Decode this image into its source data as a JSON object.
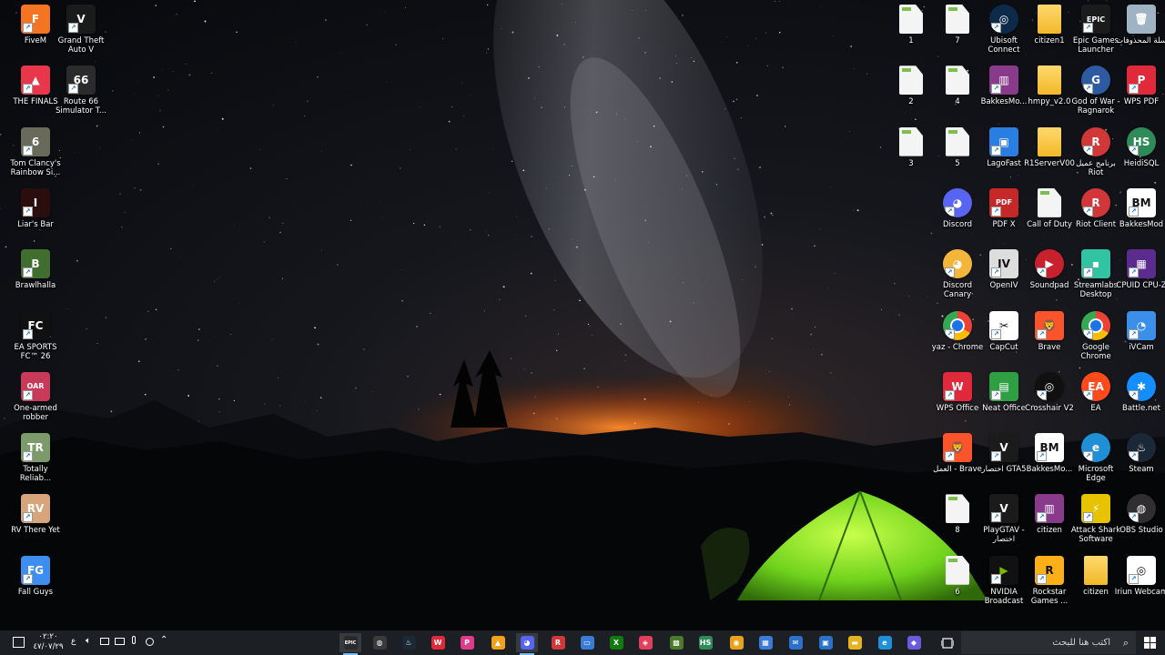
{
  "desktop": {
    "icons": [
      {
        "label": "FiveM",
        "bg": "#f47421",
        "glyph": "F",
        "shortcut": true,
        "col": 0,
        "row": 0
      },
      {
        "label": "Grand Theft Auto V",
        "bg": "#1b1b1b",
        "glyph": "V",
        "shortcut": true,
        "col": 1,
        "row": 0
      },
      {
        "label": "THE FINALS",
        "bg": "#e8374a",
        "glyph": "▲",
        "shortcut": true,
        "col": 0,
        "row": 1
      },
      {
        "label": "Route 66 Simulator T...",
        "bg": "#2b2b2b",
        "glyph": "66",
        "shortcut": true,
        "col": 1,
        "row": 1
      },
      {
        "label": "Tom Clancy's Rainbow Si...",
        "bg": "#6a6a5a",
        "glyph": "6",
        "shortcut": true,
        "col": 0,
        "row": 2
      },
      {
        "label": "Liar's Bar",
        "bg": "#2a0d0d",
        "glyph": "I",
        "shortcut": true,
        "col": 0,
        "row": 3
      },
      {
        "label": "Brawlhalla",
        "bg": "#3f6e2f",
        "glyph": "B",
        "shortcut": true,
        "col": 0,
        "row": 4
      },
      {
        "label": "EA SPORTS FC™ 26",
        "bg": "#111111",
        "glyph": "FC",
        "shortcut": true,
        "col": 0,
        "row": 5
      },
      {
        "label": "One-armed robber",
        "bg": "#c93a5a",
        "glyph": "OAR",
        "shortcut": true,
        "col": 0,
        "row": 6
      },
      {
        "label": "Totally Reliab...",
        "bg": "#7c9a6a",
        "glyph": "TR",
        "shortcut": true,
        "col": 0,
        "row": 7
      },
      {
        "label": "RV There Yet",
        "bg": "#d8a47c",
        "glyph": "RV",
        "shortcut": true,
        "col": 0,
        "row": 8
      },
      {
        "label": "Fall Guys",
        "bg": "#3d8ef0",
        "glyph": "FG",
        "shortcut": true,
        "col": 0,
        "row": 9
      },
      {
        "label": "1",
        "type": "file",
        "col": 2,
        "row": 0
      },
      {
        "label": "7",
        "type": "file",
        "col": 3,
        "row": 0
      },
      {
        "label": "Ubisoft Connect",
        "bg": "#0e2a4a",
        "glyph": "◎",
        "shortcut": true,
        "col": 4,
        "row": 0,
        "round": true
      },
      {
        "label": "citizen1",
        "type": "folder",
        "col": 5,
        "row": 0
      },
      {
        "label": "Epic Games Launcher",
        "bg": "#1b1b1b",
        "glyph": "EPIC",
        "shortcut": true,
        "col": 6,
        "row": 0
      },
      {
        "label": "سلة المحذوفات",
        "bg": "#9fb3c4",
        "glyph": "🗑",
        "shortcut": false,
        "col": 7,
        "row": 0
      },
      {
        "label": "2",
        "type": "file",
        "col": 2,
        "row": 1
      },
      {
        "label": "4",
        "type": "file",
        "col": 3,
        "row": 1
      },
      {
        "label": "BakkesMo...",
        "bg": "#8a3a8a",
        "glyph": "▥",
        "shortcut": true,
        "col": 4,
        "row": 1
      },
      {
        "label": "hmpy_v2.0",
        "type": "folder",
        "col": 5,
        "row": 1
      },
      {
        "label": "God of War - Ragnarok",
        "bg": "#2d5aa0",
        "glyph": "G",
        "shortcut": true,
        "col": 6,
        "row": 1,
        "round": true
      },
      {
        "label": "WPS PDF",
        "bg": "#e02a3c",
        "glyph": "P",
        "shortcut": true,
        "col": 7,
        "row": 1
      },
      {
        "label": "3",
        "type": "file",
        "col": 2,
        "row": 2
      },
      {
        "label": "5",
        "type": "file",
        "col": 3,
        "row": 2
      },
      {
        "label": "LagoFast",
        "bg": "#2a7de1",
        "glyph": "▣",
        "shortcut": true,
        "col": 4,
        "row": 2
      },
      {
        "label": "R1ServerV00",
        "type": "folder",
        "col": 5,
        "row": 2
      },
      {
        "label": "برنامج عميل Riot",
        "bg": "#d13639",
        "glyph": "R",
        "shortcut": true,
        "col": 6,
        "row": 2,
        "round": true
      },
      {
        "label": "HeidiSQL",
        "bg": "#2e8b57",
        "glyph": "HS",
        "shortcut": true,
        "col": 7,
        "row": 2,
        "round": true
      },
      {
        "label": "Discord",
        "bg": "#5865f2",
        "glyph": "◕",
        "shortcut": true,
        "col": 3,
        "row": 3,
        "round": true
      },
      {
        "label": "PDF X",
        "bg": "#c62828",
        "glyph": "PDF",
        "shortcut": true,
        "col": 4,
        "row": 3
      },
      {
        "label": "Call of Duty",
        "type": "file",
        "col": 5,
        "row": 3
      },
      {
        "label": "Riot Client",
        "bg": "#d13639",
        "glyph": "R",
        "shortcut": true,
        "col": 6,
        "row": 3,
        "round": true
      },
      {
        "label": "BakkesMod",
        "bg": "#ffffff",
        "glyph": "BM",
        "shortcut": true,
        "col": 7,
        "row": 3,
        "dark": true
      },
      {
        "label": "Discord Canary",
        "bg": "#f4b63a",
        "glyph": "◕",
        "shortcut": true,
        "col": 3,
        "row": 4,
        "round": true
      },
      {
        "label": "OpenIV",
        "bg": "#dddddd",
        "glyph": "IV",
        "shortcut": true,
        "col": 4,
        "row": 4,
        "dark": true
      },
      {
        "label": "Soundpad",
        "bg": "#c8202c",
        "glyph": "▶",
        "shortcut": true,
        "col": 5,
        "row": 4,
        "round": true
      },
      {
        "label": "Streamlabs Desktop",
        "bg": "#31c3a2",
        "glyph": "▪",
        "shortcut": true,
        "col": 6,
        "row": 4
      },
      {
        "label": "CPUID CPU-Z",
        "bg": "#5b2c8e",
        "glyph": "▦",
        "shortcut": true,
        "col": 7,
        "row": 4
      },
      {
        "label": "yaz - Chrome",
        "bg": "#ffffff",
        "glyph": "◉",
        "shortcut": true,
        "col": 3,
        "row": 5,
        "round": true,
        "chrome": true
      },
      {
        "label": "CapCut",
        "bg": "#ffffff",
        "glyph": "✂",
        "shortcut": true,
        "col": 4,
        "row": 5,
        "dark": true
      },
      {
        "label": "Brave",
        "bg": "#fb542b",
        "glyph": "🦁",
        "shortcut": true,
        "col": 5,
        "row": 5
      },
      {
        "label": "Google Chrome",
        "bg": "#ffffff",
        "glyph": "◉",
        "shortcut": true,
        "col": 6,
        "row": 5,
        "round": true,
        "chrome": true
      },
      {
        "label": "iVCam",
        "bg": "#3b8fe8",
        "glyph": "◔",
        "shortcut": true,
        "col": 7,
        "row": 5
      },
      {
        "label": "WPS Office",
        "bg": "#e02a3c",
        "glyph": "W",
        "shortcut": true,
        "col": 3,
        "row": 6
      },
      {
        "label": "Neat Office",
        "bg": "#2ea043",
        "glyph": "▤",
        "shortcut": true,
        "col": 4,
        "row": 6
      },
      {
        "label": "Crosshair V2",
        "bg": "#101010",
        "glyph": "◎",
        "shortcut": true,
        "col": 5,
        "row": 6,
        "round": true
      },
      {
        "label": "EA",
        "bg": "#ff4a1c",
        "glyph": "EA",
        "shortcut": true,
        "col": 6,
        "row": 6,
        "round": true
      },
      {
        "label": "Battle.net",
        "bg": "#148eff",
        "glyph": "✱",
        "shortcut": true,
        "col": 7,
        "row": 6,
        "round": true
      },
      {
        "label": "العمل - Brave",
        "bg": "#fb542b",
        "glyph": "🦁",
        "shortcut": true,
        "col": 3,
        "row": 7
      },
      {
        "label": "اختصار GTA5",
        "bg": "#1b1b1b",
        "glyph": "V",
        "shortcut": true,
        "col": 4,
        "row": 7
      },
      {
        "label": "BakkesMo...",
        "bg": "#ffffff",
        "glyph": "BM",
        "shortcut": true,
        "col": 5,
        "row": 7,
        "dark": true
      },
      {
        "label": "Microsoft Edge",
        "bg": "#1f8fd6",
        "glyph": "e",
        "shortcut": true,
        "col": 6,
        "row": 7,
        "round": true
      },
      {
        "label": "Steam",
        "bg": "#1b2838",
        "glyph": "♨",
        "shortcut": true,
        "col": 7,
        "row": 7,
        "round": true
      },
      {
        "label": "8",
        "type": "file",
        "col": 3,
        "row": 8
      },
      {
        "label": "PlayGTAV - اختصار",
        "bg": "#1b1b1b",
        "glyph": "V",
        "shortcut": true,
        "col": 4,
        "row": 8
      },
      {
        "label": "citizen",
        "bg": "#8a3a8a",
        "glyph": "▥",
        "shortcut": true,
        "col": 5,
        "row": 8
      },
      {
        "label": "Attack Shark Software",
        "bg": "#e6c200",
        "glyph": "⚡",
        "shortcut": true,
        "col": 6,
        "row": 8
      },
      {
        "label": "OBS Studio",
        "bg": "#302e31",
        "glyph": "◍",
        "shortcut": true,
        "col": 7,
        "row": 8,
        "round": true
      },
      {
        "label": "6",
        "type": "file",
        "col": 3,
        "row": 9
      },
      {
        "label": "NVIDIA Broadcast",
        "bg": "#111111",
        "glyph": "▶",
        "shortcut": true,
        "col": 4,
        "row": 9,
        "nv": true
      },
      {
        "label": "Rockstar Games ...",
        "bg": "#fcaf17",
        "glyph": "R",
        "shortcut": true,
        "col": 5,
        "row": 9,
        "dark": true
      },
      {
        "label": "citizen",
        "type": "folder",
        "col": 6,
        "row": 9
      },
      {
        "label": "Iriun Webcam",
        "bg": "#ffffff",
        "glyph": "◎",
        "shortcut": true,
        "col": 7,
        "row": 9,
        "dark": true
      }
    ]
  },
  "taskbar": {
    "search_placeholder": "اكتب هنا للبحث",
    "apps": [
      {
        "name": "epic",
        "glyph": "EPIC",
        "bg": "#2a2a2a",
        "active": true
      },
      {
        "name": "obs",
        "glyph": "◍",
        "bg": "#3a3a3a"
      },
      {
        "name": "steam",
        "glyph": "♨",
        "bg": "#1b2838"
      },
      {
        "name": "wps",
        "glyph": "W",
        "bg": "#e02a3c"
      },
      {
        "name": "wps-pdf",
        "glyph": "P",
        "bg": "#e03a8a"
      },
      {
        "name": "finals",
        "glyph": "▲",
        "bg": "#f2a21a"
      },
      {
        "name": "discord",
        "glyph": "◕",
        "bg": "#5865f2",
        "active": true
      },
      {
        "name": "riot",
        "glyph": "R",
        "bg": "#d13639"
      },
      {
        "name": "task-view",
        "glyph": "▭",
        "bg": "#3a7bd5"
      },
      {
        "name": "xbox",
        "glyph": "X",
        "bg": "#107c10"
      },
      {
        "name": "store-game",
        "glyph": "◈",
        "bg": "#e0405a"
      },
      {
        "name": "minecraft",
        "glyph": "▩",
        "bg": "#4a7a2a"
      },
      {
        "name": "heidisql",
        "glyph": "HS",
        "bg": "#2e8b57"
      },
      {
        "name": "chrome",
        "glyph": "◉",
        "bg": "#e8a21a"
      },
      {
        "name": "ms-store",
        "glyph": "▦",
        "bg": "#3a7bd5"
      },
      {
        "name": "outlook",
        "glyph": "✉",
        "bg": "#2a72c9"
      },
      {
        "name": "app-window",
        "glyph": "▣",
        "bg": "#2a72c9"
      },
      {
        "name": "file-explorer",
        "glyph": "▬",
        "bg": "#e6b422"
      },
      {
        "name": "edge",
        "glyph": "e",
        "bg": "#1f8fd6"
      },
      {
        "name": "copilot",
        "glyph": "◆",
        "bg": "#6a5ae0"
      }
    ],
    "tray": {
      "time": "٠٢:٢٠",
      "date": "٤٧/٠٧/٢٩",
      "lang": "ع",
      "notif_icon": "notification-icon"
    }
  }
}
